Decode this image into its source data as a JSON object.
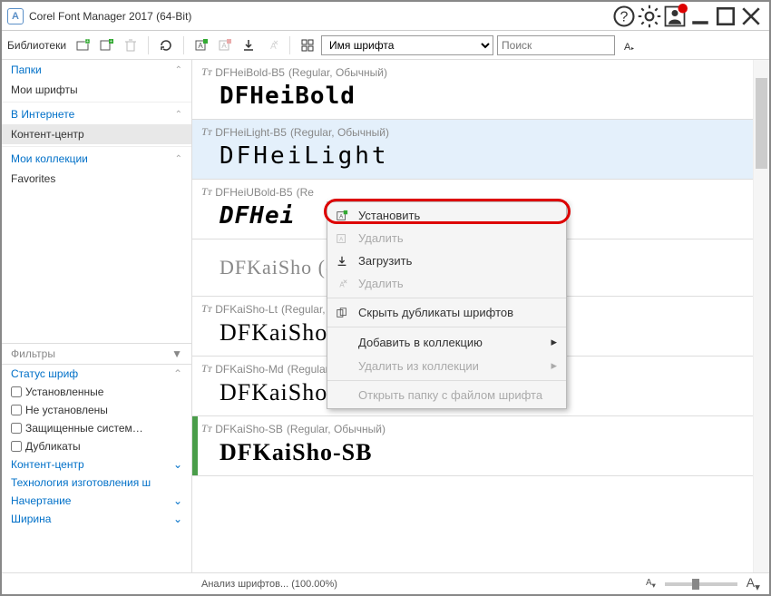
{
  "window": {
    "title": "Corel Font Manager 2017 (64-Bit)"
  },
  "toolbar": {
    "libraries_label": "Библиотеки",
    "sort_selected": "Имя шрифта",
    "search_placeholder": "Поиск"
  },
  "sidebar": {
    "folders_label": "Папки",
    "my_fonts": "Мои шрифты",
    "internet": "В Интернете",
    "content_center": "Контент-центр",
    "my_collections": "Мои коллекции",
    "favorites": "Favorites",
    "filters_label": "Фильтры",
    "status_header": "Статус шриф",
    "installed": "Установленные",
    "not_installed": "Не установлены",
    "protected_system": "Защищенные систем…",
    "duplicates": "Дубликаты",
    "content_center_filter": "Контент-центр",
    "technology": "Технология изготовления ш",
    "style": "Начертание",
    "width": "Ширина"
  },
  "fonts": [
    {
      "name": "DFHeiBold-B5",
      "meta": "(Regular, Обычный)",
      "preview": "DFHeiBold"
    },
    {
      "name": "DFHeiLight-B5",
      "meta": "(Regular, Обычный)",
      "preview": "DFHeiLight",
      "selected": true
    },
    {
      "name": "DFHeiUBold-B5",
      "meta": "(Re",
      "preview": "DFHei"
    },
    {
      "name": "",
      "meta": "",
      "preview": "DFKaiSho (сем"
    },
    {
      "name": "DFKaiSho-Lt",
      "meta": "(Regular, Обычный)",
      "preview": "DFKaiSho"
    },
    {
      "name": "DFKaiSho-Md",
      "meta": "(Regular, Обычный)",
      "preview": "DFKaiSho"
    },
    {
      "name": "DFKaiSho-SB",
      "meta": "(Regular, Обычный)",
      "preview": "DFKaiSho-SB",
      "green": true
    }
  ],
  "context_menu": {
    "install": "Установить",
    "delete1": "Удалить",
    "download": "Загрузить",
    "delete2": "Удалить",
    "hide_duplicates": "Скрыть дубликаты шрифтов",
    "add_to_collection": "Добавить в коллекцию",
    "remove_from_collection": "Удалить из коллекции",
    "open_folder": "Открыть папку с файлом шрифта"
  },
  "statusbar": {
    "status_text": "Анализ шрифтов... (100.00%)"
  }
}
